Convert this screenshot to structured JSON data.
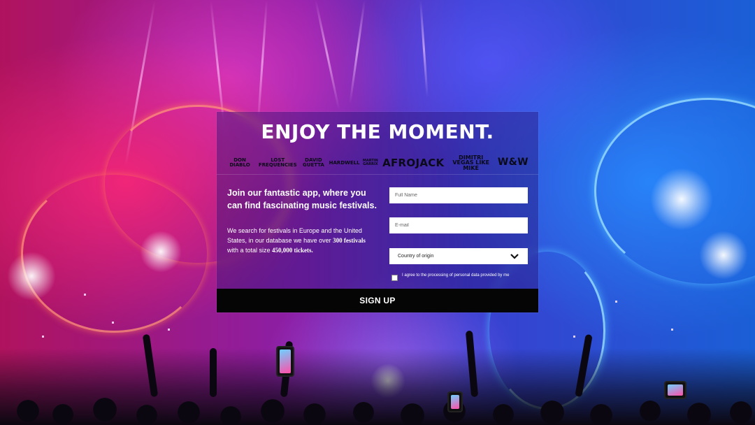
{
  "hero": {
    "title": "ENJOY THE MOMENT."
  },
  "logos": {
    "items": [
      {
        "label": "DON DIABLO",
        "icon": "don-diablo-logo"
      },
      {
        "label": "LOST FREQUENCIES",
        "icon": "lost-frequencies-logo"
      },
      {
        "label": "DAVID GUETTA",
        "icon": "david-guetta-logo"
      },
      {
        "label": "HARDWELL",
        "icon": "hardwell-logo"
      },
      {
        "label": "MARTIN GARRIX",
        "icon": "martin-garrix-logo"
      },
      {
        "label": "AFROJACK",
        "icon": "afrojack-logo"
      },
      {
        "label": "DIMITRI VEGAS LIKE MIKE",
        "icon": "dimitri-vegas-like-mike-logo"
      },
      {
        "label": "W&W",
        "icon": "w-and-w-logo"
      }
    ]
  },
  "intro": {
    "lead": "Join our fantastic app, where you can find fascinating music festivals.",
    "desc_prefix": "We search for festivals in Europe and the United States, in our database we have over",
    "festival_count": "300 festivals",
    "desc_middle": "with a total size",
    "ticket_count": "450,000 tickets."
  },
  "form": {
    "full_name_placeholder": "Full Name",
    "full_name_value": "",
    "email_placeholder": "E-mail",
    "email_value": "",
    "country_selected": "Country of origin",
    "consent_text": "I agree to the processing of personal data provided by me",
    "consent_checked": false,
    "submit_label": "SIGN UP"
  },
  "colors": {
    "card_overlay": "#281478",
    "button_bg": "#050505",
    "text": "#ffffff"
  }
}
